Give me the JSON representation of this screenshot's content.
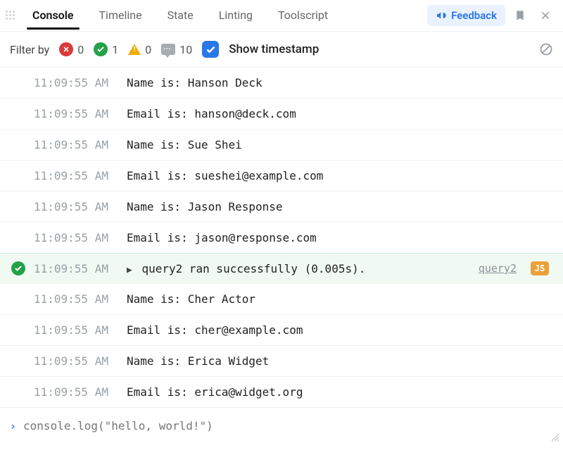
{
  "tabs": [
    {
      "label": "Console",
      "active": true
    },
    {
      "label": "Timeline",
      "active": false
    },
    {
      "label": "State",
      "active": false
    },
    {
      "label": "Linting",
      "active": false
    },
    {
      "label": "Toolscript",
      "active": false
    }
  ],
  "header": {
    "feedback_label": "Feedback"
  },
  "filters": {
    "label": "Filter by",
    "error_count": "0",
    "success_count": "1",
    "warning_count": "0",
    "message_count": "10",
    "show_timestamp_label": "Show timestamp",
    "show_timestamp_checked": true
  },
  "logs": [
    {
      "timestamp": "11:09:55 AM",
      "message": "Name is: Hanson Deck",
      "type": "plain"
    },
    {
      "timestamp": "11:09:55 AM",
      "message": "Email is: hanson@deck.com",
      "type": "plain"
    },
    {
      "timestamp": "11:09:55 AM",
      "message": "Name is: Sue Shei",
      "type": "plain"
    },
    {
      "timestamp": "11:09:55 AM",
      "message": "Email is: sueshei@example.com",
      "type": "plain"
    },
    {
      "timestamp": "11:09:55 AM",
      "message": "Name is: Jason Response",
      "type": "plain"
    },
    {
      "timestamp": "11:09:55 AM",
      "message": "Email is: jason@response.com",
      "type": "plain"
    },
    {
      "timestamp": "11:09:55 AM",
      "message": "query2 ran successfully (0.005s).",
      "type": "success",
      "link": "query2",
      "badge": "JS"
    },
    {
      "timestamp": "11:09:55 AM",
      "message": "Name is: Cher Actor",
      "type": "plain"
    },
    {
      "timestamp": "11:09:55 AM",
      "message": "Email is: cher@example.com",
      "type": "plain"
    },
    {
      "timestamp": "11:09:55 AM",
      "message": "Name is: Erica Widget",
      "type": "plain"
    },
    {
      "timestamp": "11:09:55 AM",
      "message": "Email is: erica@widget.org",
      "type": "plain"
    }
  ],
  "input": {
    "placeholder": "console.log(\"hello, world!\")"
  }
}
